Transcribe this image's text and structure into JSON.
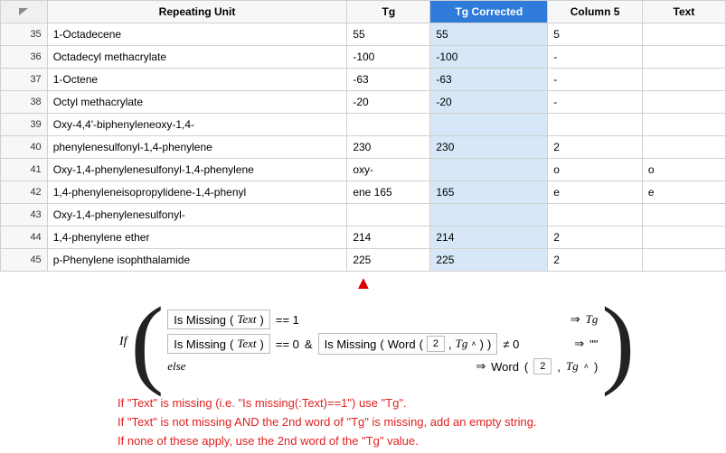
{
  "table": {
    "headers": {
      "repeating_unit": "Repeating Unit",
      "tg": "Tg",
      "tg_corrected": "Tg Corrected",
      "column5": "Column 5",
      "text": "Text"
    },
    "rows": [
      {
        "n": "35",
        "ru": "1-Octadecene",
        "tg": "55",
        "tgc": "55",
        "c5": "5",
        "txt": ""
      },
      {
        "n": "36",
        "ru": "Octadecyl methacrylate",
        "tg": "-100",
        "tgc": "-100",
        "c5": "-",
        "txt": ""
      },
      {
        "n": "37",
        "ru": "1-Octene",
        "tg": "-63",
        "tgc": "-63",
        "c5": "-",
        "txt": ""
      },
      {
        "n": "38",
        "ru": "Octyl methacrylate",
        "tg": "-20",
        "tgc": "-20",
        "c5": "-",
        "txt": ""
      },
      {
        "n": "39",
        "ru": "Oxy-4,4'-biphenyleneoxy-1,4-",
        "tg": "",
        "tgc": "",
        "c5": "",
        "txt": ""
      },
      {
        "n": "40",
        "ru": "phenylenesulfonyl-1,4-phenylene",
        "tg": "230",
        "tgc": "230",
        "c5": "2",
        "txt": ""
      },
      {
        "n": "41",
        "ru": "Oxy-1,4-phenylenesulfonyl-1,4-phenylene",
        "tg": "oxy-",
        "tgc": "",
        "c5": "o",
        "txt": "o"
      },
      {
        "n": "42",
        "ru": " 1,4-phenyleneisopropylidene-1,4-phenyl",
        "tg": "ene 165",
        "tgc": "165",
        "c5": "e",
        "txt": "e"
      },
      {
        "n": "43",
        "ru": "Oxy-1,4-phenylenesulfonyl-",
        "tg": "",
        "tgc": "",
        "c5": "",
        "txt": ""
      },
      {
        "n": "44",
        "ru": "1,4-phenylene ether",
        "tg": "214",
        "tgc": "214",
        "c5": "2",
        "txt": ""
      },
      {
        "n": "45",
        "ru": "p-Phenylene isophthalamide",
        "tg": "225",
        "tgc": "225",
        "c5": "2",
        "txt": ""
      }
    ]
  },
  "formula": {
    "if_label": "If",
    "else_label": "else",
    "ismissing": "Is Missing",
    "text_var": "Text",
    "tg_var": "Tg",
    "word_fn": "Word",
    "two": "2",
    "eq1": "== 1",
    "eq0": "== 0",
    "ne0": "≠ 0",
    "amp": "&",
    "implies": "⇒",
    "empty": "\"\""
  },
  "explain": {
    "l1": "If \"Text\" is missing (i.e. \"Is missing(:Text)==1\") use \"Tg\".",
    "l2": "If \"Text\" is not missing AND the 2nd word of \"Tg\" is missing, add an empty string.",
    "l3": "If none of these apply, use the 2nd word of the \"Tg\" value."
  }
}
